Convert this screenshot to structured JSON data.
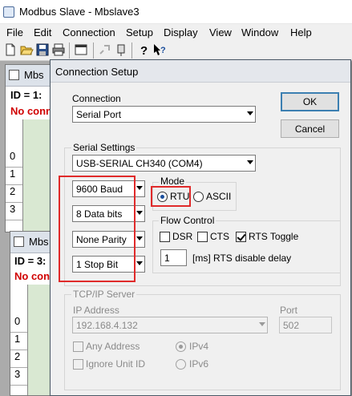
{
  "app": {
    "title": "Modbus Slave - Mbslave3"
  },
  "menu": [
    "File",
    "Edit",
    "Connection",
    "Setup",
    "Display",
    "View",
    "Window",
    "Help"
  ],
  "toolbar": {
    "icons": [
      "new-icon",
      "open-icon",
      "save-icon",
      "print-icon",
      "window-icon",
      "connect-icon",
      "disconnect-icon",
      "help-icon",
      "context-help-icon"
    ]
  },
  "child1": {
    "title": "Mbs",
    "id_text": "ID = 1: ",
    "status": "No conn",
    "rows": [
      "0",
      "1",
      "2",
      "3"
    ]
  },
  "child2": {
    "title": "Mbs",
    "id_text": "ID = 3: ",
    "status": "No conn",
    "rows": [
      "0",
      "1",
      "2",
      "3"
    ]
  },
  "dialog": {
    "title": "Connection Setup",
    "connection": {
      "label": "Connection",
      "value": "Serial Port"
    },
    "ok_label": "OK",
    "cancel_label": "Cancel",
    "serial": {
      "label": "Serial Settings",
      "port": "USB-SERIAL CH340 (COM4)",
      "baud": "9600 Baud",
      "data_bits": "8 Data bits",
      "parity": "None Parity",
      "stop_bits": "1 Stop Bit"
    },
    "mode": {
      "label": "Mode",
      "rtu": "RTU",
      "ascii": "ASCII",
      "selected": "RTU"
    },
    "flow": {
      "label": "Flow Control",
      "dsr": "DSR",
      "cts": "CTS",
      "rts_toggle": "RTS Toggle",
      "dsr_checked": false,
      "cts_checked": false,
      "rts_checked": true,
      "delay_value": "1",
      "delay_label": "[ms] RTS disable delay"
    },
    "tcp": {
      "label": "TCP/IP Server",
      "ip_label": "IP Address",
      "ip_value": "192.168.4.132",
      "port_label": "Port",
      "port_value": "502",
      "any_address": "Any Address",
      "ignore_unit": "Ignore Unit ID",
      "ipv4": "IPv4",
      "ipv6": "IPv6",
      "selected_ip": "IPv4"
    }
  },
  "colors": {
    "highlight": "#e02a2a",
    "error_text": "#d00000",
    "grid": "#d9e8d2"
  }
}
